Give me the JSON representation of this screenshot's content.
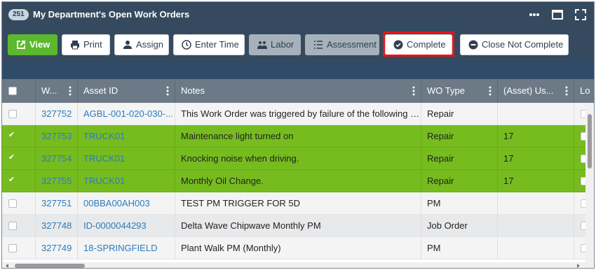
{
  "window": {
    "count_badge": "251",
    "title": "My Department's Open Work Orders",
    "icons": [
      "more-horizontal-icon",
      "maximize-window-icon",
      "fullscreen-icon"
    ]
  },
  "toolbar": {
    "buttons": [
      {
        "label": "View",
        "icon": "open-external-icon",
        "style": "primary"
      },
      {
        "label": "Print",
        "icon": "printer-icon",
        "style": "default"
      },
      {
        "label": "Assign",
        "icon": "user-icon",
        "style": "default"
      },
      {
        "label": "Enter Time",
        "icon": "clock-icon",
        "style": "default"
      },
      {
        "label": "Labor",
        "icon": "labor-icon",
        "style": "disabled"
      },
      {
        "label": "Assessment",
        "icon": "list-icon",
        "style": "disabled"
      },
      {
        "label": "Complete",
        "icon": "check-circle-icon",
        "style": "default",
        "highlighted": true
      },
      {
        "label": "Close Not Complete",
        "icon": "minus-circle-icon",
        "style": "default"
      }
    ]
  },
  "grid": {
    "columns": [
      "W...",
      "Asset ID",
      "Notes",
      "WO Type",
      "(Asset) Us...",
      "Lo"
    ],
    "rows": [
      {
        "wo": "327752",
        "asset": "AGBL-001-020-030-...",
        "notes": "This Work Order was triggered by failure of the following C...",
        "type": "Repair",
        "usage": "",
        "selected": false
      },
      {
        "wo": "327753",
        "asset": "TRUCK01",
        "notes": "Maintenance light turned on",
        "type": "Repair",
        "usage": "17",
        "selected": true
      },
      {
        "wo": "327754",
        "asset": "TRUCK01",
        "notes": "Knocking noise when driving.",
        "type": "Repair",
        "usage": "17",
        "selected": true
      },
      {
        "wo": "327755",
        "asset": "TRUCK01",
        "notes": "Monthly Oil Change.",
        "type": "Repair",
        "usage": "17",
        "selected": true
      },
      {
        "wo": "327751",
        "asset": "00BBA00AH003",
        "notes": "TEST PM TRIGGER FOR 5D",
        "type": "PM",
        "usage": "",
        "selected": false
      },
      {
        "wo": "327748",
        "asset": "ID-0000044293",
        "notes": "Delta Wave Chipwave Monthly PM",
        "type": "Job Order",
        "usage": "",
        "selected": false
      },
      {
        "wo": "327749",
        "asset": "18-SPRINGFIELD",
        "notes": "Plant Walk PM (Monthly)",
        "type": "PM",
        "usage": "",
        "selected": false
      }
    ]
  },
  "colors": {
    "title_bar": "#354a5e",
    "primary_button": "#5cb82e",
    "selected_row": "#76bc1f",
    "highlight_border": "#e8141c",
    "link": "#2b7bbf"
  }
}
